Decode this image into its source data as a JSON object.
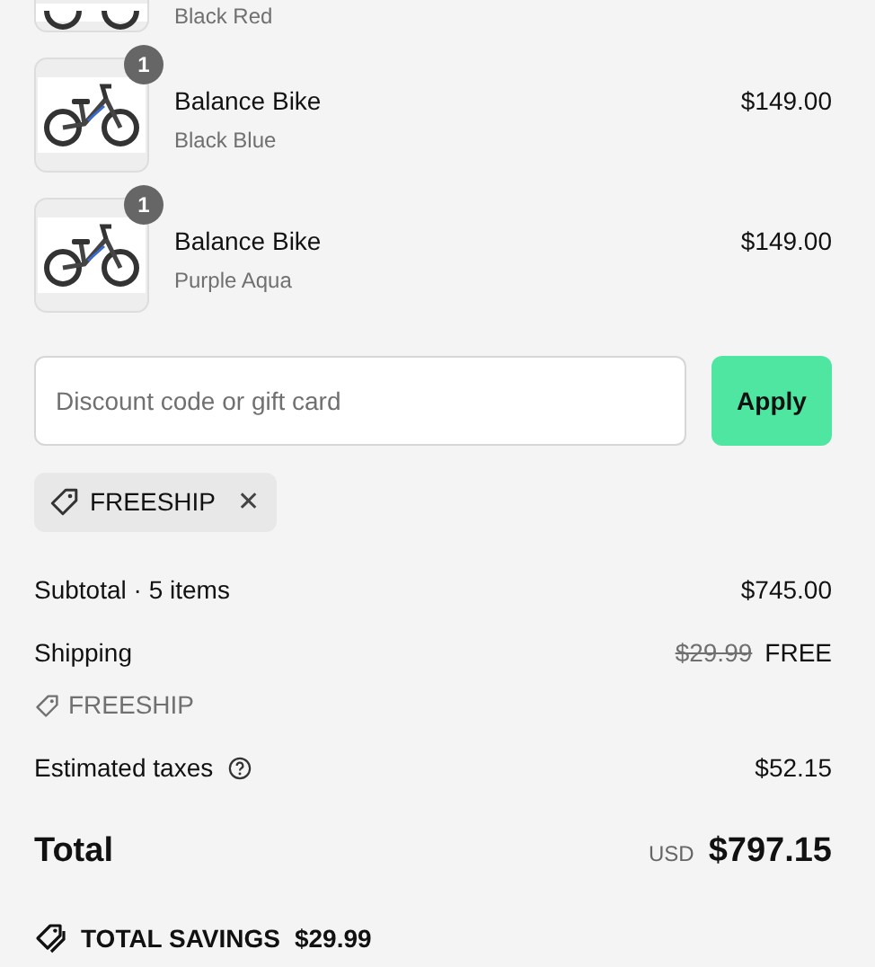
{
  "cut_item": {
    "variant": "Black Red"
  },
  "items": [
    {
      "quantity": "1",
      "title": "Balance Bike",
      "variant": "Black Blue",
      "price": "$149.00"
    },
    {
      "quantity": "1",
      "title": "Balance Bike",
      "variant": "Purple Aqua",
      "price": "$149.00"
    }
  ],
  "discount": {
    "placeholder": "Discount code or gift card",
    "button": "Apply"
  },
  "applied_codes": [
    {
      "code": "FREESHIP",
      "remove": "✕"
    }
  ],
  "summary": {
    "subtotal_label": "Subtotal · 5 items",
    "subtotal": "$745.00",
    "shipping_label": "Shipping",
    "shipping_original": "$29.99",
    "shipping": "FREE",
    "shipping_code": "FREESHIP",
    "taxes_label": "Estimated taxes",
    "taxes": "$52.15",
    "total_label": "Total",
    "currency": "USD",
    "total": "$797.15",
    "savings_label": "TOTAL SAVINGS",
    "savings": "$29.99"
  }
}
